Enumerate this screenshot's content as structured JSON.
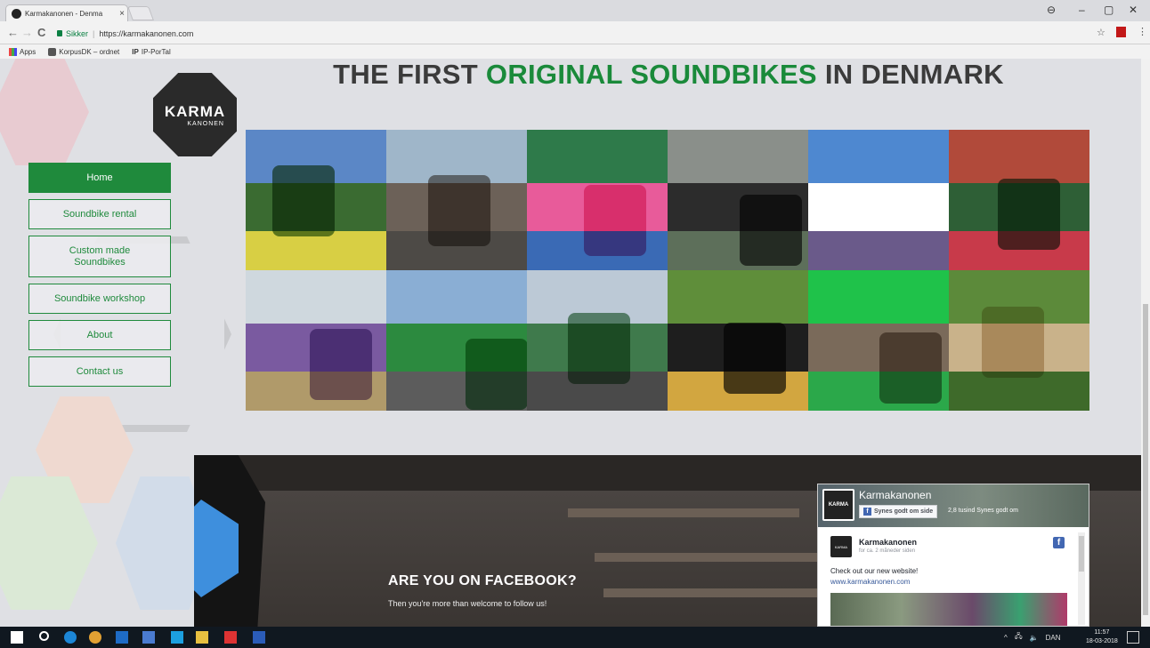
{
  "browser": {
    "tab_title": "Karmakanonen - Denma",
    "tab_close": "×",
    "window_controls": {
      "profile": "⊖",
      "minimize": "–",
      "maximize": "▢",
      "close": "✕"
    },
    "nav": {
      "back": "←",
      "forward": "→",
      "reload": "C"
    },
    "address": {
      "secure_label": "Sikker",
      "url": "https://karmakanonen.com"
    },
    "bookmark_star": "☆",
    "menu": "⋮",
    "bookmarks": [
      {
        "label": "Apps",
        "icon": "apps-icon"
      },
      {
        "label": "KorpusDK – ordnet",
        "icon": "korpus-icon"
      },
      {
        "label": "IP-PorTal",
        "icon": "ip-icon",
        "prefix": "IP"
      }
    ]
  },
  "site": {
    "logo": {
      "line1": "KARMA",
      "line2": "KANONEN"
    },
    "headline": {
      "part1": "THE FIRST ",
      "highlight": "ORIGINAL SOUNDBIKES",
      "part2": " IN DENMARK"
    },
    "nav": [
      {
        "label": "Home",
        "active": true
      },
      {
        "label": "Soundbike rental",
        "active": false
      },
      {
        "label": "Custom made Soundbikes",
        "active": false
      },
      {
        "label": "Soundbike workshop",
        "active": false
      },
      {
        "label": "About",
        "active": false
      },
      {
        "label": "Contact us",
        "active": false
      }
    ],
    "photos": [
      {
        "name": "group-photo",
        "colors": [
          "#5b87c6",
          "#3a6b31",
          "#d8cf44"
        ]
      },
      {
        "name": "street-photo",
        "colors": [
          "#9fb6c9",
          "#6c6158",
          "#4d4a46"
        ]
      },
      {
        "name": "dots-wall-photo",
        "colors": [
          "#2e7a4a",
          "#e85b9a",
          "#3a6ab5"
        ]
      },
      {
        "name": "cyclist-photo",
        "colors": [
          "#8a8f8a",
          "#2c2c2c",
          "#5d6f5a"
        ]
      },
      {
        "name": "bridge-crowd-photo",
        "colors": [
          "#4e88d0",
          "#ffffff",
          "#6a5a8a"
        ]
      },
      {
        "name": "parade-photo",
        "colors": [
          "#b14a3a",
          "#2e5f36",
          "#c83a4a"
        ]
      },
      {
        "name": "festival-tent-photo",
        "colors": [
          "#cfd8de",
          "#7a5aa0",
          "#b09a6a"
        ]
      },
      {
        "name": "harbour-bike-photo",
        "colors": [
          "#8aaed4",
          "#2c8a3f",
          "#5c5c5c"
        ]
      },
      {
        "name": "canal-photo",
        "colors": [
          "#bcc9d6",
          "#3f7a4c",
          "#4a4a4a"
        ]
      },
      {
        "name": "night-light-photo",
        "colors": [
          "#5f8e3a",
          "#1e1e1e",
          "#d2a640"
        ]
      },
      {
        "name": "heart-frame-photo",
        "colors": [
          "#1fc24a",
          "#7a6a5a",
          "#2ba84a"
        ]
      },
      {
        "name": "dancing-photo",
        "colors": [
          "#5c8a3a",
          "#c9b28a",
          "#3e6a2a"
        ]
      }
    ],
    "facebook": {
      "title": "ARE YOU ON FACEBOOK?",
      "subtitle": "Then you're more than welcome to follow us!",
      "widget": {
        "page_name": "Karmakanonen",
        "like_label": "Synes godt om side",
        "fb_glyph": "f",
        "likes_text": "2,8 tusind Synes godt om",
        "avatar_text": "KARMA",
        "post": {
          "author": "Karmakanonen",
          "time": "for ca. 2 måneder siden",
          "text": "Check out our new website!",
          "link": "www.karmakanonen.com"
        }
      }
    }
  },
  "taskbar": {
    "tray_items": [
      "^",
      "🖧",
      "🔈",
      "DAN"
    ],
    "time": "11:57",
    "date": "18-03-2018",
    "icons": [
      "windows-start-icon",
      "search-icon",
      "edge-icon",
      "chrome-icon",
      "outlook-icon",
      "app-icon",
      "skype-icon",
      "file-explorer-icon",
      "acrobat-icon",
      "word-icon",
      "notification-icon"
    ]
  },
  "colors": {
    "brand_green": "#1f8a3c",
    "headline_green": "#1a8a3a",
    "facebook_blue": "#4267b2"
  }
}
